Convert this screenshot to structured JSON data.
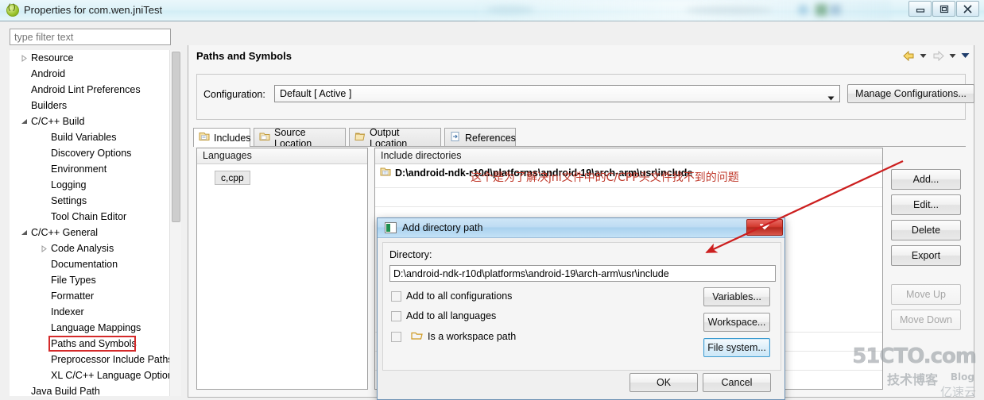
{
  "window": {
    "title": "Properties for com.wen.jniTest",
    "icon": "eclipse-properties-icon",
    "buttons": {
      "minimize": "minimize",
      "maximize": "maximize",
      "close": "close"
    }
  },
  "sidebar": {
    "filter_placeholder": "type filter text",
    "filter_value": "",
    "items": [
      {
        "label": "Resource",
        "indent": 0,
        "twisty": "collapsed",
        "selected": false
      },
      {
        "label": "Android",
        "indent": 0,
        "twisty": "none",
        "selected": false
      },
      {
        "label": "Android Lint Preferences",
        "indent": 0,
        "twisty": "none",
        "selected": false
      },
      {
        "label": "Builders",
        "indent": 0,
        "twisty": "none",
        "selected": false
      },
      {
        "label": "C/C++ Build",
        "indent": 0,
        "twisty": "expanded",
        "selected": false
      },
      {
        "label": "Build Variables",
        "indent": 1,
        "twisty": "none",
        "selected": false
      },
      {
        "label": "Discovery Options",
        "indent": 1,
        "twisty": "none",
        "selected": false
      },
      {
        "label": "Environment",
        "indent": 1,
        "twisty": "none",
        "selected": false
      },
      {
        "label": "Logging",
        "indent": 1,
        "twisty": "none",
        "selected": false
      },
      {
        "label": "Settings",
        "indent": 1,
        "twisty": "none",
        "selected": false
      },
      {
        "label": "Tool Chain Editor",
        "indent": 1,
        "twisty": "none",
        "selected": false
      },
      {
        "label": "C/C++ General",
        "indent": 0,
        "twisty": "expanded",
        "selected": false
      },
      {
        "label": "Code Analysis",
        "indent": 1,
        "twisty": "collapsed",
        "selected": false
      },
      {
        "label": "Documentation",
        "indent": 1,
        "twisty": "none",
        "selected": false
      },
      {
        "label": "File Types",
        "indent": 1,
        "twisty": "none",
        "selected": false
      },
      {
        "label": "Formatter",
        "indent": 1,
        "twisty": "none",
        "selected": false
      },
      {
        "label": "Indexer",
        "indent": 1,
        "twisty": "none",
        "selected": false
      },
      {
        "label": "Language Mappings",
        "indent": 1,
        "twisty": "none",
        "selected": false
      },
      {
        "label": "Paths and Symbols",
        "indent": 1,
        "twisty": "none",
        "selected": true
      },
      {
        "label": "Preprocessor Include Paths",
        "indent": 1,
        "twisty": "none",
        "selected": false
      },
      {
        "label": "XL C/C++ Language Option",
        "indent": 1,
        "twisty": "none",
        "selected": false
      },
      {
        "label": "Java Build Path",
        "indent": 0,
        "twisty": "none",
        "selected": false
      }
    ]
  },
  "page": {
    "title": "Paths and Symbols",
    "nav": {
      "back_icon": "back-arrow-icon",
      "back_menu_icon": "chevron-down-icon",
      "forward_icon": "forward-arrow-icon",
      "forward_menu_icon": "chevron-down-icon",
      "view_menu_icon": "chevron-down-icon"
    },
    "configuration": {
      "label": "Configuration:",
      "value": "Default  [ Active ]",
      "dropdown_icon": "chevron-down-icon",
      "manage_button": "Manage Configurations..."
    },
    "tabs": [
      {
        "label": "Includes",
        "icon": "includes-icon",
        "active": true
      },
      {
        "label": "Source Location",
        "icon": "folder-source-icon",
        "active": false
      },
      {
        "label": "Output Location",
        "icon": "folder-output-icon",
        "active": false
      },
      {
        "label": "References",
        "icon": "references-icon",
        "active": false
      }
    ],
    "languages": {
      "header": "Languages",
      "items": [
        "c,cpp"
      ]
    },
    "includes": {
      "header": "Include directories",
      "items": [
        {
          "icon": "include-folder-icon",
          "path": "D:\\android-ndk-r10d\\platforms\\android-19\\arch-arm\\usr\\include"
        }
      ]
    },
    "annotation_note": "这个是为了解决jni文件中的C/CPP头文件找不到的问题",
    "annotation_color": "#c0392b",
    "side_buttons": [
      {
        "label": "Add...",
        "enabled": true
      },
      {
        "label": "Edit...",
        "enabled": true
      },
      {
        "label": "Delete",
        "enabled": true
      },
      {
        "label": "Export",
        "enabled": true
      },
      {
        "label": "Move Up",
        "enabled": false
      },
      {
        "label": "Move Down",
        "enabled": false
      }
    ]
  },
  "dialog": {
    "title": "Add directory path",
    "icon": "dialog-icon",
    "close_icon": "close-icon",
    "directory_label": "Directory:",
    "directory_value": "D:\\android-ndk-r10d\\platforms\\android-19\\arch-arm\\usr\\include",
    "checkboxes": [
      {
        "label": "Add to all configurations",
        "checked": false,
        "icon": null
      },
      {
        "label": "Add to all languages",
        "checked": false,
        "icon": null
      },
      {
        "label": "Is a workspace path",
        "checked": false,
        "icon": "folder-icon"
      }
    ],
    "side_buttons": [
      {
        "label": "Variables...",
        "focused": false
      },
      {
        "label": "Workspace...",
        "focused": false
      },
      {
        "label": "File system...",
        "focused": true
      }
    ],
    "ok_button": "OK",
    "cancel_button": "Cancel"
  },
  "watermark": {
    "line1": "51CTO.com",
    "line2": "技术博客",
    "line3": "Blog",
    "line4": "亿速云"
  }
}
